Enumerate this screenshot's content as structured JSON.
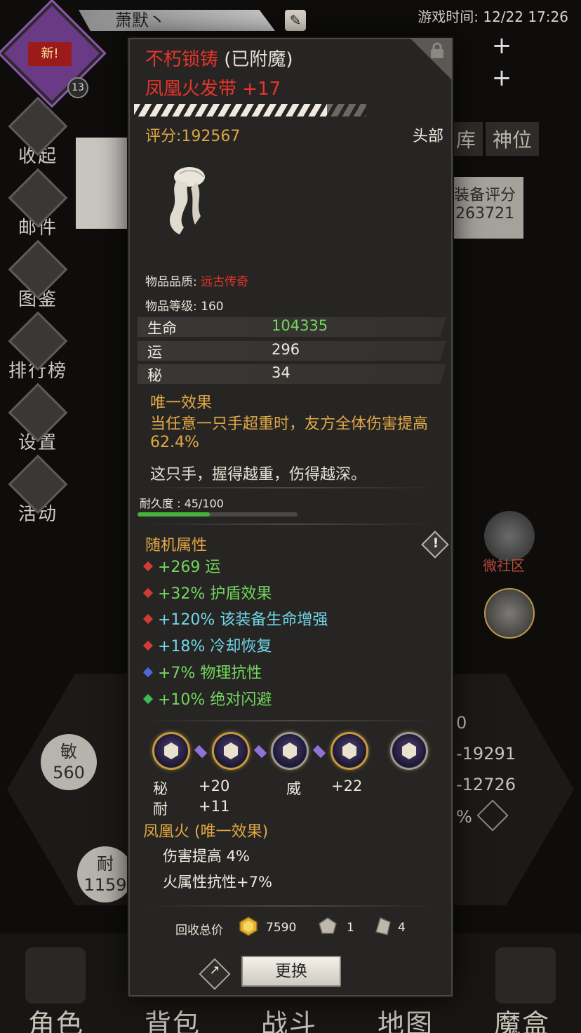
{
  "background": {
    "player_name": "萧默丶",
    "game_time": "游戏时间: 12/22 17:26",
    "badge_new": "新!",
    "badge_level": "13",
    "side_menu": [
      "收起",
      "邮件",
      "图鉴",
      "排行榜",
      "设置",
      "活动"
    ],
    "right_tabs": [
      "库",
      "神位"
    ],
    "equip_score_label": "装备评分",
    "equip_score_value": "263721",
    "social_label": "微社区",
    "stat_circles": [
      {
        "label": "敏",
        "value": "560"
      },
      {
        "label": "耐",
        "value": "1159"
      }
    ],
    "right_numbers": [
      "0",
      "-19291",
      "-12726",
      "%"
    ],
    "bottom_tabs": [
      "角色",
      "背包",
      "战斗",
      "地图",
      "魔盒"
    ]
  },
  "item": {
    "enchant_prefix": "不朽锁铸",
    "enchant_suffix": " (已附魔)",
    "name": "凤凰火发带 +17",
    "score": "评分:192567",
    "slot": "头部",
    "quality_label": "物品品质: ",
    "quality_value": "远古传奇",
    "level": "物品等级: 160",
    "stats": [
      {
        "name": "生命",
        "value": "104335"
      },
      {
        "name": "运",
        "value": "296"
      },
      {
        "name": "秘",
        "value": "34"
      }
    ],
    "unique_title": "唯一效果",
    "unique_desc": "当任意一只手超重时，友方全体伤害提高 62.4%",
    "flavor": "这只手，握得越重，伤得越深。",
    "durability_label": "耐久度 : 45/100",
    "durability_fraction": 0.45,
    "random_title": "随机属性",
    "random_attrs": [
      {
        "text": "+269 运",
        "color": "#72d65e",
        "gem": "#d23a3a"
      },
      {
        "text": "+32% 护盾效果",
        "color": "#72d65e",
        "gem": "#d23a3a"
      },
      {
        "text": "+120% 该装备生命增强",
        "color": "#6ed8e8",
        "gem": "#d23a3a"
      },
      {
        "text": "+18% 冷却恢复",
        "color": "#6ed8e8",
        "gem": "#d23a3a"
      },
      {
        "text": "+7% 物理抗性",
        "color": "#72d65e",
        "gem": "#4a6ad8"
      },
      {
        "text": "+10% 绝对闪避",
        "color": "#72d65e",
        "gem": "#3fb85a"
      }
    ],
    "gem_stats": [
      {
        "label": "秘",
        "value": "+20"
      },
      {
        "label": "耐",
        "value": "+11"
      },
      {
        "label": "威",
        "value": "+22"
      }
    ],
    "set_title": "凤凰火 (唯一效果)",
    "set_lines": [
      "伤害提高 4%",
      "火属性抗性+7%"
    ],
    "recycle_label": "回收总价",
    "recycle": {
      "gold": "7590",
      "mat1": "1",
      "mat2": "4"
    },
    "replace_button": "更换"
  }
}
